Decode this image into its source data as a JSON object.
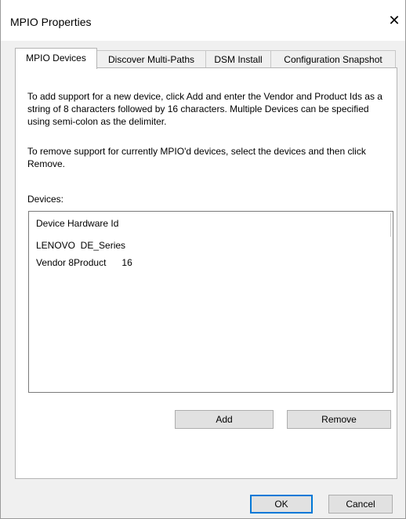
{
  "window": {
    "title": "MPIO Properties",
    "close_glyph": "✕"
  },
  "tabs": [
    {
      "label": "MPIO Devices"
    },
    {
      "label": "Discover Multi-Paths"
    },
    {
      "label": "DSM Install"
    },
    {
      "label": "Configuration Snapshot"
    }
  ],
  "panel": {
    "instructions_add": "To add support for a new device, click Add and enter the Vendor and Product Ids as a string of 8 characters followed by 16 characters. Multiple Devices can be specified using semi-colon as the delimiter.",
    "instructions_remove": "To remove support for currently MPIO'd devices, select the devices and then click Remove.",
    "devices_label": "Devices:",
    "list": {
      "header": "Device Hardware Id",
      "rows": [
        "LENOVO  DE_Series",
        "Vendor 8Product      16"
      ]
    },
    "add_label": "Add",
    "remove_label": "Remove"
  },
  "footer": {
    "ok_label": "OK",
    "cancel_label": "Cancel"
  },
  "colors": {
    "accent": "#0078d7",
    "titlebar_accent": "#c0392b"
  }
}
